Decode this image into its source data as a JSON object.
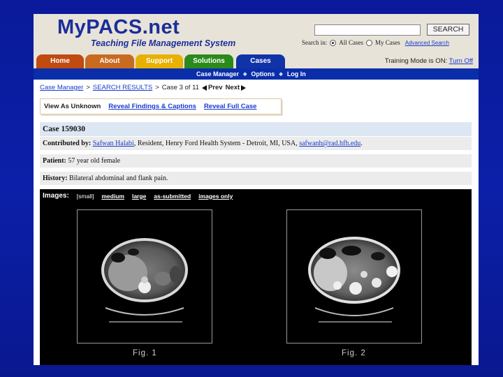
{
  "header": {
    "logo_title": "MyPACS.net",
    "logo_subtitle": "Teaching File Management System",
    "search_button": "SEARCH",
    "search_in_label": "Search in:",
    "search_opt_all": "All Cases",
    "search_opt_my": "My Cases",
    "advanced_search": "Advanced Search"
  },
  "tabs": [
    {
      "label": "Home"
    },
    {
      "label": "About"
    },
    {
      "label": "Support"
    },
    {
      "label": "Solutions"
    },
    {
      "label": "Cases"
    }
  ],
  "training": {
    "text": "Training Mode is ON:",
    "link": "Turn Off"
  },
  "subnav": {
    "items": [
      "Case Manager",
      "Options",
      "Log In"
    ]
  },
  "breadcrumb": {
    "case_manager": "Case Manager",
    "sep": ">",
    "search_results": "SEARCH RESULTS",
    "current": "Case 3 of 11",
    "prev": "Prev",
    "next": "Next"
  },
  "view_tabs": {
    "unknown": "View As Unknown",
    "findings": "Reveal Findings & Captions",
    "full": "Reveal Full Case"
  },
  "case": {
    "title": "Case 159030",
    "contributed_label": "Contributed by:",
    "contributor_name": "Safwan Halabi",
    "contributor_info": ", Resident, Henry Ford Health System - Detroit, MI, USA, ",
    "contributor_email": "safwanh@rad.hfh.edu",
    "contributor_end": ".",
    "patient_label": "Patient:",
    "patient_value": "57 year old female",
    "history_label": "History:",
    "history_value": "Bilateral abdominal and flank pain."
  },
  "images": {
    "label": "Images:",
    "sizes": [
      "[small]",
      "medium",
      "large",
      "as-submitted",
      "images only"
    ],
    "fig1_caption": "Fig. 1",
    "fig2_caption": "Fig. 2"
  },
  "colors": {
    "background": "#0b1fa8",
    "header_bg": "#e8e3d8",
    "nav_blue": "#0a2eaa",
    "link": "#1a3ccc",
    "tab_home": "#c04a10",
    "tab_about": "#c86a20",
    "tab_support": "#e8b000",
    "tab_solutions": "#2a8a1a",
    "tab_cases": "#1133a8"
  }
}
